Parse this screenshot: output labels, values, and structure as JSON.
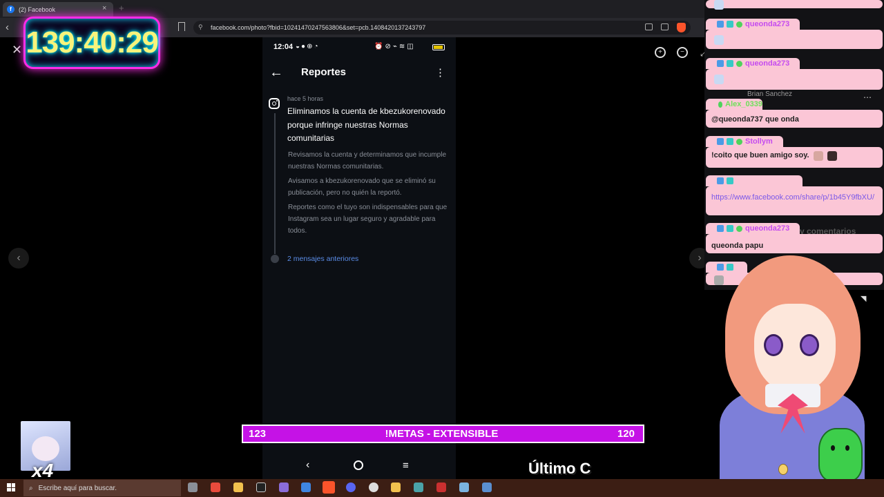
{
  "browser": {
    "tab_title": "(2) Facebook",
    "tab_close": "×",
    "new_tab": "+",
    "url": "facebook.com/photo?fbid=10241470247563806&set=pcb.1408420137243797"
  },
  "viewer": {
    "close": "✕",
    "prev": "‹",
    "next": "›",
    "zoom_in": "+",
    "zoom_out": "−"
  },
  "phone": {
    "time": "12:04",
    "page_title": "Reportes",
    "message": {
      "time": "hace 5 horas",
      "headline": "Eliminamos la cuenta de kbezukorenovado porque infringe nuestras Normas comunitarias",
      "para1": "Revisamos la cuenta y determinamos que incumple nuestras Normas comunitarias.",
      "para2": "Avisamos a kbezukorenovado que se eliminó su publicación, pero no quién la reportó.",
      "para3": "Reportes como el tuyo son indispensables para que Instagram sea un lugar seguro y agradable para todos."
    },
    "prev_messages": "2 mensajes anteriores"
  },
  "overlay": {
    "timer": "139:40:29",
    "metas_left": "123",
    "metas_label": "!METAS - EXTENSIBLE",
    "metas_right": "120",
    "ultimo": "Último C",
    "multiplier": "x4"
  },
  "chat": {
    "messages": [
      {
        "user": "queonda273",
        "text": ""
      },
      {
        "user": "queonda273",
        "text": ""
      },
      {
        "user": "Alex_0339",
        "text": "@queonda737 que onda"
      },
      {
        "user": "Stollym",
        "text": "!coito que buen amigo soy."
      },
      {
        "user": "",
        "text": "https://www.facebook.com/share/p/1b45Y9fbXU/"
      },
      {
        "user": "queonda273",
        "text": "queonda papu"
      }
    ],
    "ghost_name": "Brian Sanchez",
    "ghost_comments": "y comentarios"
  },
  "taskbar": {
    "search_placeholder": "Escribe aquí para buscar."
  }
}
